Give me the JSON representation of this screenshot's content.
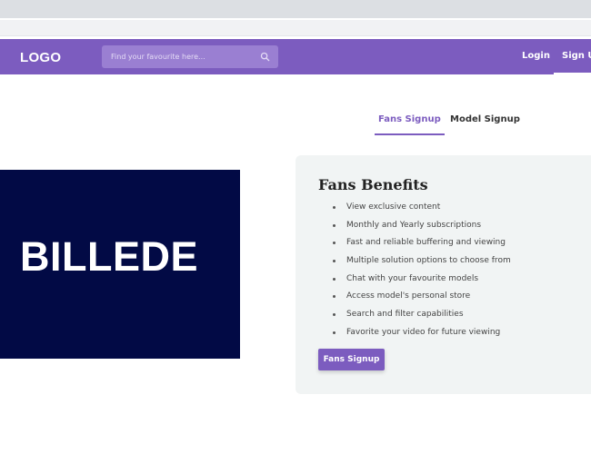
{
  "header": {
    "logo": "LOGO",
    "search_placeholder": "Find your favourite here...",
    "login_label": "Login",
    "signup_label": "Sign Up"
  },
  "tabs": [
    {
      "label": "Fans Signup",
      "active": true
    },
    {
      "label": "Model Signup",
      "active": false
    }
  ],
  "hero_image": {
    "label": "BILLEDE"
  },
  "benefits": {
    "title": "Fans Benefits",
    "items": [
      "View exclusive content",
      "Monthly and Yearly subscriptions",
      "Fast and reliable buffering and viewing",
      "Multiple solution options to choose from",
      "Chat with your favourite models",
      "Access model's personal store",
      "Search and filter capabilities",
      "Favorite your video for future viewing"
    ],
    "button_label": "Fans Signup"
  },
  "colors": {
    "brand_purple": "#7c5cbf",
    "image_background": "#020a45",
    "card_background": "#f1f4f4"
  },
  "icons": {
    "search": "search-icon"
  }
}
